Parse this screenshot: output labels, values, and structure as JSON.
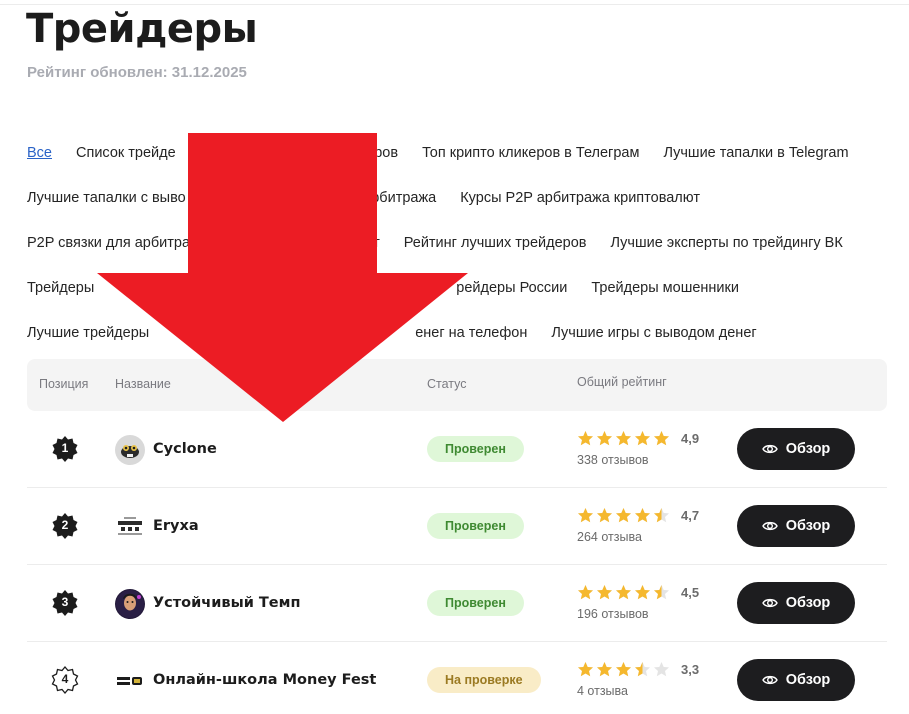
{
  "page": {
    "title": "Трейдеры",
    "updated": "Рейтинг обновлен: 31.12.2025"
  },
  "categories": [
    [
      "Все",
      "Список трейде",
      "керов",
      "Топ крипто кликеров в Телеграм",
      "Лучшие тапалки в Telegram"
    ],
    [
      "Лучшие тапалки с выво",
      "P арбитража",
      "Курсы P2P арбитража криптовалют"
    ],
    [
      "P2P связки для арбитра",
      "лют",
      "Рейтинг лучших трейдеров",
      "Лучшие эксперты по трейдингу ВК"
    ],
    [
      "Трейдеры",
      "рейдеры России",
      "Трейдеры мошенники"
    ],
    [
      "Лучшие трейдеры",
      "енег на телефон",
      "Лучшие игры с выводом денег"
    ]
  ],
  "table": {
    "headers": {
      "position": "Позиция",
      "name": "Название",
      "status": "Статус",
      "rating": "Общий рейтинг"
    },
    "rows": [
      {
        "position": "1",
        "name": "Cyclone",
        "status": "Проверен",
        "status_kind": "verified",
        "rating": "4,9",
        "rating_value": 4.9,
        "reviews": "338 отзывов",
        "button": "Обзор"
      },
      {
        "position": "2",
        "name": "Eryxa",
        "status": "Проверен",
        "status_kind": "verified",
        "rating": "4,7",
        "rating_value": 4.7,
        "reviews": "264 отзыва",
        "button": "Обзор"
      },
      {
        "position": "3",
        "name": "Устойчивый Темп",
        "status": "Проверен",
        "status_kind": "verified",
        "rating": "4,5",
        "rating_value": 4.5,
        "reviews": "196 отзывов",
        "button": "Обзор"
      },
      {
        "position": "4",
        "name": "Онлайн-школа Money Fest",
        "status": "На проверке",
        "status_kind": "pending",
        "rating": "3,3",
        "rating_value": 3.3,
        "reviews": "4 отзыва",
        "button": "Обзор"
      }
    ]
  },
  "overlay": {
    "icon": "red-down-arrow",
    "color": "#ec1c24"
  },
  "colors": {
    "star": "#f5b82e",
    "star_empty": "#e4e4e4",
    "button": "#1d1d1f",
    "link_active": "#2a63c7"
  }
}
